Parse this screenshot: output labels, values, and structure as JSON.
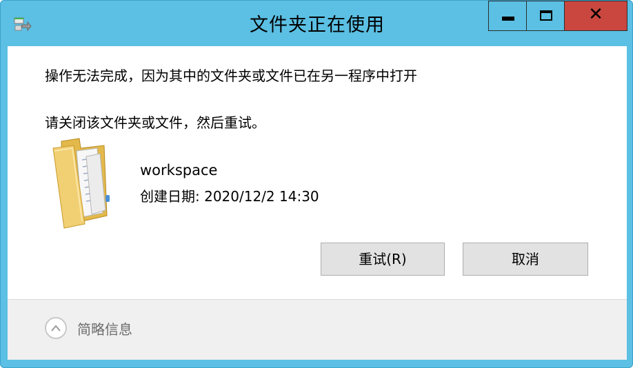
{
  "window": {
    "title": "文件夹正在使用",
    "controls": {
      "minimize": "minimize-icon",
      "maximize": "maximize-icon",
      "close": "close-icon"
    },
    "colors": {
      "frame": "#5bc0e3",
      "close": "#c9473f"
    }
  },
  "message": {
    "line1": "操作无法完成，因为其中的文件夹或文件已在另一程序中打开",
    "line2": "请关闭该文件夹或文件，然后重试。"
  },
  "item": {
    "icon": "folder-icon",
    "name": "workspace",
    "created": "创建日期: 2020/12/2 14:30"
  },
  "buttons": {
    "retry": "重试(R)",
    "cancel": "取消"
  },
  "footer": {
    "details_label": "简略信息",
    "icon": "chevron-up-icon"
  }
}
